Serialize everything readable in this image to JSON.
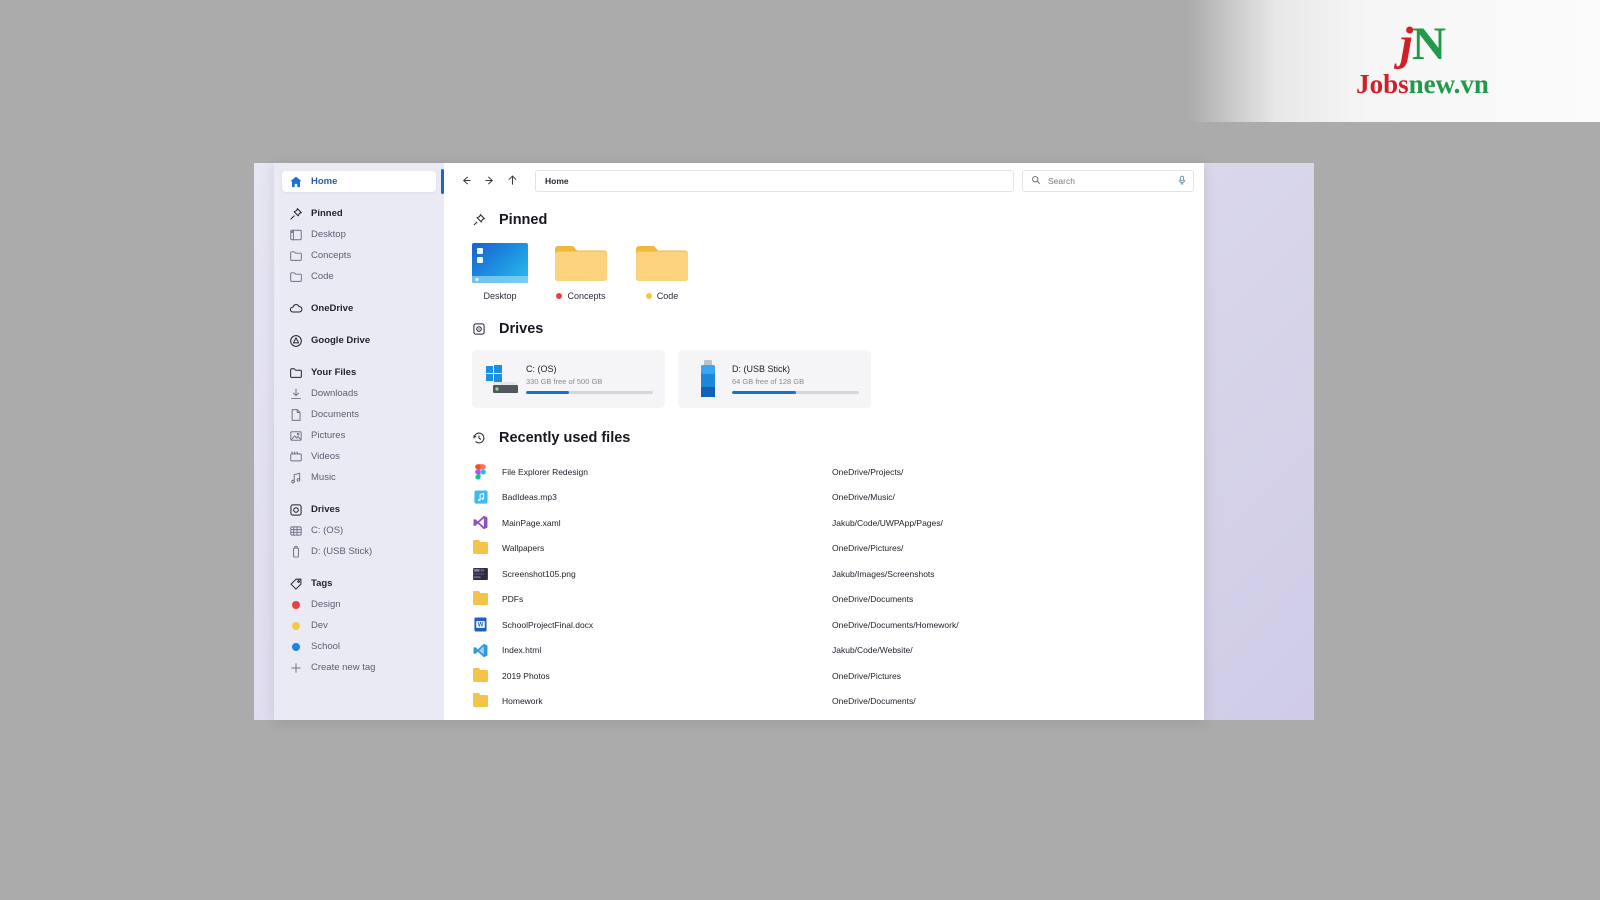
{
  "logo": {
    "mark_j": "j",
    "mark_n": "N",
    "text_red": "Jobs",
    "text_green": "new.vn"
  },
  "toolbar": {
    "back_icon": "arrow-left-icon",
    "forward_icon": "arrow-right-icon",
    "up_icon": "arrow-up-icon",
    "breadcrumb": "Home",
    "search_placeholder": "Search",
    "search_value": "",
    "mic_icon": "microphone-icon"
  },
  "sidebar": {
    "groups": [
      {
        "items": [
          {
            "label": "Home",
            "icon": "home-icon",
            "selected": true
          }
        ]
      },
      {
        "items": [
          {
            "label": "Pinned",
            "icon": "pin-icon",
            "header": true
          },
          {
            "label": "Desktop",
            "icon": "desktop-icon"
          },
          {
            "label": "Concepts",
            "icon": "folder-icon"
          },
          {
            "label": "Code",
            "icon": "folder-icon"
          }
        ]
      },
      {
        "items": [
          {
            "label": "OneDrive",
            "icon": "cloud-icon",
            "header": true
          }
        ]
      },
      {
        "items": [
          {
            "label": "Google Drive",
            "icon": "google-drive-icon",
            "header": true
          }
        ]
      },
      {
        "items": [
          {
            "label": "Your Files",
            "icon": "folder-icon",
            "header": true
          },
          {
            "label": "Downloads",
            "icon": "download-icon"
          },
          {
            "label": "Documents",
            "icon": "document-icon"
          },
          {
            "label": "Pictures",
            "icon": "picture-icon"
          },
          {
            "label": "Videos",
            "icon": "video-icon"
          },
          {
            "label": "Music",
            "icon": "music-icon"
          }
        ]
      },
      {
        "items": [
          {
            "label": "Drives",
            "icon": "drive-icon",
            "header": true
          },
          {
            "label": "C: (OS)",
            "icon": "hard-disk-icon"
          },
          {
            "label": "D: (USB Stick)",
            "icon": "usb-icon"
          }
        ]
      },
      {
        "items": [
          {
            "label": "Tags",
            "icon": "tag-icon",
            "header": true
          },
          {
            "label": "Design",
            "icon": "color-dot-icon",
            "color": "#e8413f"
          },
          {
            "label": "Dev",
            "icon": "color-dot-icon",
            "color": "#f5c842"
          },
          {
            "label": "School",
            "icon": "color-dot-icon",
            "color": "#1a84e2"
          },
          {
            "label": "Create new tag",
            "icon": "plus-icon"
          }
        ]
      }
    ]
  },
  "pinned": {
    "title": "Pinned",
    "icon": "pin-icon",
    "items": [
      {
        "name": "Desktop",
        "thumb": "desktop-thumbnail",
        "dot": null
      },
      {
        "name": "Concepts",
        "thumb": "folder-icon",
        "dot": "#e8413f"
      },
      {
        "name": "Code",
        "thumb": "folder-icon",
        "dot": "#f5c842"
      }
    ]
  },
  "drives": {
    "title": "Drives",
    "icon": "drive-icon",
    "items": [
      {
        "name": "C: (OS)",
        "free_text": "330 GB free of 500 GB",
        "used_percent": 34,
        "icon": "windows-hard-disk-icon"
      },
      {
        "name": "D: (USB Stick)",
        "free_text": "64 GB free of 128 GB",
        "used_percent": 50,
        "icon": "usb-stick-icon"
      }
    ]
  },
  "recent": {
    "title": "Recently used files",
    "icon": "history-clock-icon",
    "files": [
      {
        "name": "File Explorer Redesign",
        "path": "OneDrive/Projects/",
        "icon": "figma-icon"
      },
      {
        "name": "BadIdeas.mp3",
        "path": "OneDrive/Music/",
        "icon": "music-file-icon"
      },
      {
        "name": "MainPage.xaml",
        "path": "Jakub/Code/UWPApp/Pages/",
        "icon": "visual-studio-icon"
      },
      {
        "name": "Wallpapers",
        "path": "OneDrive/Pictures/",
        "icon": "folder-icon"
      },
      {
        "name": "Screenshot105.png",
        "path": "Jakub/Images/Screenshots",
        "icon": "image-thumbnail-icon"
      },
      {
        "name": "PDFs",
        "path": "OneDrive/Documents",
        "icon": "folder-icon"
      },
      {
        "name": "SchoolProjectFinal.docx",
        "path": "OneDrive/Documents/Homework/",
        "icon": "word-icon"
      },
      {
        "name": "Index.html",
        "path": "Jakub/Code/Website/",
        "icon": "vscode-icon"
      },
      {
        "name": "2019 Photos",
        "path": "OneDrive/Pictures",
        "icon": "folder-icon"
      },
      {
        "name": "Homework",
        "path": "OneDrive/Documents/",
        "icon": "folder-icon"
      }
    ]
  }
}
